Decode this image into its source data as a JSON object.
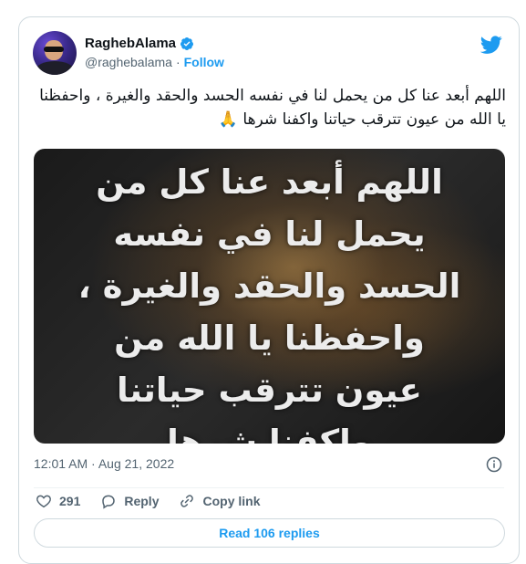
{
  "author": {
    "display_name": "RaghebAlama",
    "handle": "@raghebalama",
    "separator": "·",
    "follow_label": "Follow"
  },
  "tweet": {
    "text": "اللهم أبعد عنا كل من يحمل لنا في نفسه الحسد والحقد والغيرة ، واحفظنا يا الله من عيون تترقب حياتنا واكفنا شرها 🙏",
    "image_text": "اللهم أبعد عنا كل من يحمل لنا في نفسه الحسد والحقد والغيرة ، واحفظنا يا الله من عيون تترقب حياتنا واكفنا شرها",
    "time": "12:01 AM",
    "separator": "·",
    "date": "Aug 21, 2022"
  },
  "actions": {
    "likes": "291",
    "reply_label": "Reply",
    "copy_link_label": "Copy link"
  },
  "read_replies_label": "Read 106 replies",
  "colors": {
    "accent": "#1d9bf0",
    "muted": "#536471",
    "like": "#536471"
  },
  "icons": [
    "verified-badge-icon",
    "twitter-bird-icon",
    "info-icon",
    "heart-icon",
    "reply-bubble-icon",
    "link-icon"
  ]
}
